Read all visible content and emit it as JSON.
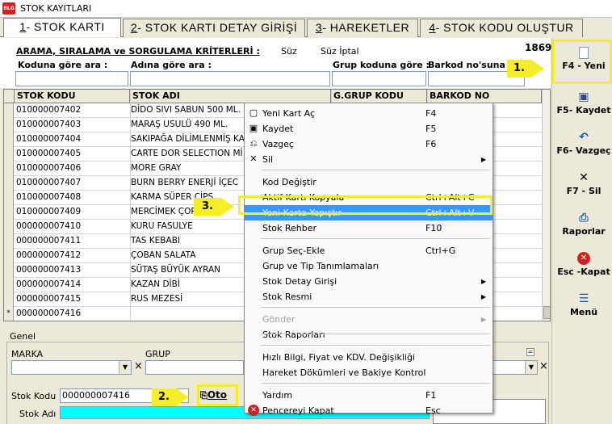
{
  "window": {
    "title": "STOK KAYITLARI"
  },
  "tabs": [
    {
      "key": "1",
      "label": "- STOK KARTI"
    },
    {
      "key": "2",
      "label": "- STOK KARTI DETAY GİRİŞİ"
    },
    {
      "key": "3",
      "label": "- HAREKETLER"
    },
    {
      "key": "4",
      "label": "- STOK KODU OLUŞTUR"
    }
  ],
  "filters": {
    "title": "ARAMA, SIRALAMA ve SORGULAMA KRİTERLERİ :",
    "suz": "Süz",
    "suz_iptal": "Süz İptal",
    "count": "1869",
    "by_code": "Koduna göre ara :",
    "by_name": "Adına göre ara :",
    "by_group": "Grup koduna göre :",
    "by_barcode": "Barkod no'suna gö"
  },
  "grid": {
    "columns": [
      "STOK KODU",
      "STOK ADI",
      "G.GRUP KODU",
      "BARKOD NO"
    ],
    "rows": [
      {
        "code": "010000007402",
        "name": "DİDO SIVI SABUN 500 ML."
      },
      {
        "code": "010000007403",
        "name": "MARAŞ USULÜ 490 ML."
      },
      {
        "code": "010000007404",
        "name": "SAKIPAĞA DİLİMLENMİŞ KA"
      },
      {
        "code": "010000007405",
        "name": "CARTE DOR SELECTION Mİ"
      },
      {
        "code": "010000007406",
        "name": "MORE GRAY"
      },
      {
        "code": "010000007407",
        "name": "BURN BERRY ENERJİ İÇEC"
      },
      {
        "code": "010000007408",
        "name": "KARMA SÜPER CİPS"
      },
      {
        "code": "010000007409",
        "name": "MERCİMEK ÇOR"
      },
      {
        "code": "000000007410",
        "name": "KURU FASULYE"
      },
      {
        "code": "000000007411",
        "name": "TAS KEBABI"
      },
      {
        "code": "000000007412",
        "name": "ÇOBAN SALATA"
      },
      {
        "code": "000000007413",
        "name": "SÜTAŞ BÜYÜK AYRAN"
      },
      {
        "code": "000000007414",
        "name": "KAZAN DİBİ"
      },
      {
        "code": "000000007415",
        "name": "RUS MEZESİ"
      },
      {
        "code": "000000007416",
        "name": ""
      }
    ],
    "new_row_marker": "*"
  },
  "lower": {
    "group_title": "Genel",
    "marka": "MARKA",
    "grup": "GRUP",
    "clear_x": "×",
    "stok_kodu_label": "Stok Kodu :",
    "stok_kodu_value": "000000007416",
    "stok_adi_label": "Stok Adı :",
    "oto_button": "Oto"
  },
  "toolbar": {
    "new": "F4 - Yeni",
    "save": "F5- Kaydet",
    "cancel": "F6- Vazgeç",
    "delete": "F7 - Sil",
    "reports": "Raporlar",
    "close": "Esc -Kapat",
    "menu": "Menü"
  },
  "context_menu": [
    {
      "label": "Yeni Kart Aç",
      "shortcut": "F4",
      "icon": "new-card-icon"
    },
    {
      "label": "Kaydet",
      "shortcut": "F5",
      "icon": "save-icon"
    },
    {
      "label": "Vazgeç",
      "shortcut": "F6",
      "icon": "cancel-icon"
    },
    {
      "label": "Sil",
      "shortcut": "",
      "icon": "delete-icon",
      "submenu": true
    },
    {
      "label": "Kod Değiştir",
      "shortcut": ""
    },
    {
      "label": "Aktif Kartı Kopyala",
      "shortcut": "Ctrl+Alt+C"
    },
    {
      "label": "Yeni Karta Yapıştır",
      "shortcut": "Ctrl+Alt+V",
      "highlighted": true
    },
    {
      "label": "Stok Rehber",
      "shortcut": "F10"
    },
    {
      "label": "Grup Seç-Ekle",
      "shortcut": "Ctrl+G"
    },
    {
      "label": "Grup ve Tip Tanımlamaları",
      "shortcut": ""
    },
    {
      "label": "Stok Detay Girişi",
      "shortcut": "",
      "submenu": true
    },
    {
      "label": "Stok Resmi",
      "shortcut": "",
      "submenu": true
    },
    {
      "label": "Gönder",
      "shortcut": "",
      "submenu": true,
      "disabled": true
    },
    {
      "label": "Stok Raporları",
      "shortcut": ""
    },
    {
      "label": "Hızlı Bilgi, Fiyat ve KDV. Değişikliği",
      "shortcut": ""
    },
    {
      "label": "Hareket Dökümleri ve Bakiye Kontrol",
      "shortcut": ""
    },
    {
      "label": "Yardım",
      "shortcut": "F1"
    },
    {
      "label": "Pencereyi Kapat",
      "shortcut": "Esc",
      "icon": "close-window-icon"
    }
  ],
  "callouts": {
    "one": "1.",
    "two": "2.",
    "three": "3."
  },
  "colors": {
    "highlight": "#3399ff",
    "callout": "#f7ee2a",
    "name_field": "#00ffff"
  }
}
